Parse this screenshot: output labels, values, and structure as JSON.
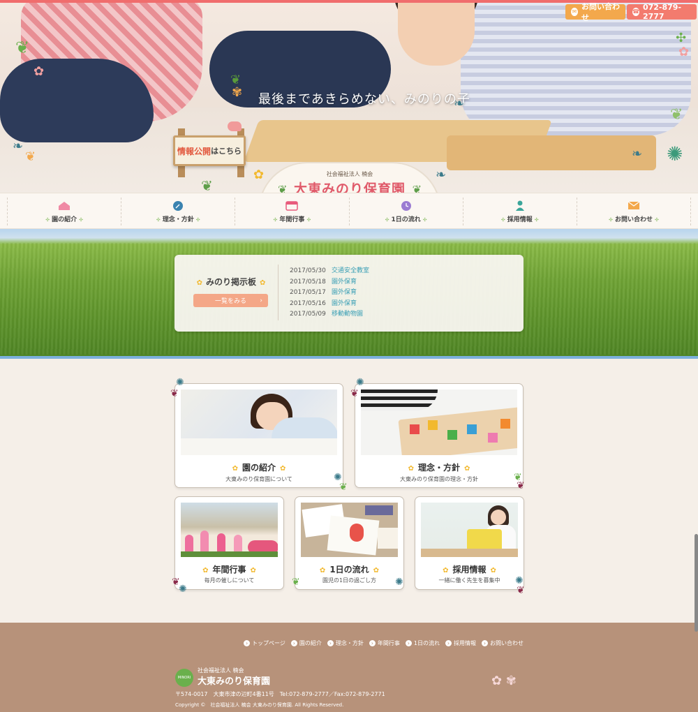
{
  "header": {
    "contact_label": "お問い合わせ",
    "phone": "072-879-2777",
    "tagline": "最後まであきらめない、みのりの子",
    "sign_highlight": "情報公開",
    "sign_rest": "はこちら",
    "logo_sub": "社会福祉法人 楠会",
    "logo_main": "大東みのり保育園"
  },
  "nav": {
    "items": [
      {
        "label": "園の紹介",
        "icon": "house-icon",
        "color": "#f08aa5"
      },
      {
        "label": "理念・方針",
        "icon": "compass-icon",
        "color": "#3b83b0"
      },
      {
        "label": "年間行事",
        "icon": "calendar-icon",
        "color": "#e85b7c"
      },
      {
        "label": "1日の流れ",
        "icon": "clock-icon",
        "color": "#9b7cd2"
      },
      {
        "label": "採用情報",
        "icon": "person-icon",
        "color": "#3aa59a"
      },
      {
        "label": "お問い合わせ",
        "icon": "mail-icon",
        "color": "#f3a84c"
      }
    ]
  },
  "board": {
    "title": "みのり掲示板",
    "button": "一覧をみる",
    "news": [
      {
        "date": "2017/05/30",
        "title": "交通安全教室"
      },
      {
        "date": "2017/05/18",
        "title": "園外保育"
      },
      {
        "date": "2017/05/17",
        "title": "園外保育"
      },
      {
        "date": "2017/05/16",
        "title": "園外保育"
      },
      {
        "date": "2017/05/09",
        "title": "移動動物園"
      }
    ]
  },
  "cards": [
    {
      "title": "園の紹介",
      "desc": "大東みのり保育園について"
    },
    {
      "title": "理念・方針",
      "desc": "大東みのり保育園の理念・方針"
    },
    {
      "title": "年間行事",
      "desc": "毎月の催しについて"
    },
    {
      "title": "1日の流れ",
      "desc": "園児の1日の過ごし方"
    },
    {
      "title": "採用情報",
      "desc": "一緒に働く先生を募集中"
    }
  ],
  "footer": {
    "links": [
      "トップページ",
      "園の紹介",
      "理念・方針",
      "年間行事",
      "1日の流れ",
      "採用情報",
      "お問い合わせ"
    ],
    "logo_sub": "社会福祉法人 楠会",
    "logo_main": "大東みのり保育園",
    "logo_mark": "MINORI",
    "address": "〒574-0017　大東市津の辺町4番11号　Tel:072-879-2777／Fax:072-879-2771",
    "copyright": "Copyright ©　社会福祉法人 楠会 大東みのり保育園. All Rights Reserved."
  },
  "colors": {
    "accent_red": "#f06d6d",
    "accent_orange": "#f3a84c",
    "link_blue": "#3a9fb5",
    "footer_brown": "#b7927a"
  }
}
